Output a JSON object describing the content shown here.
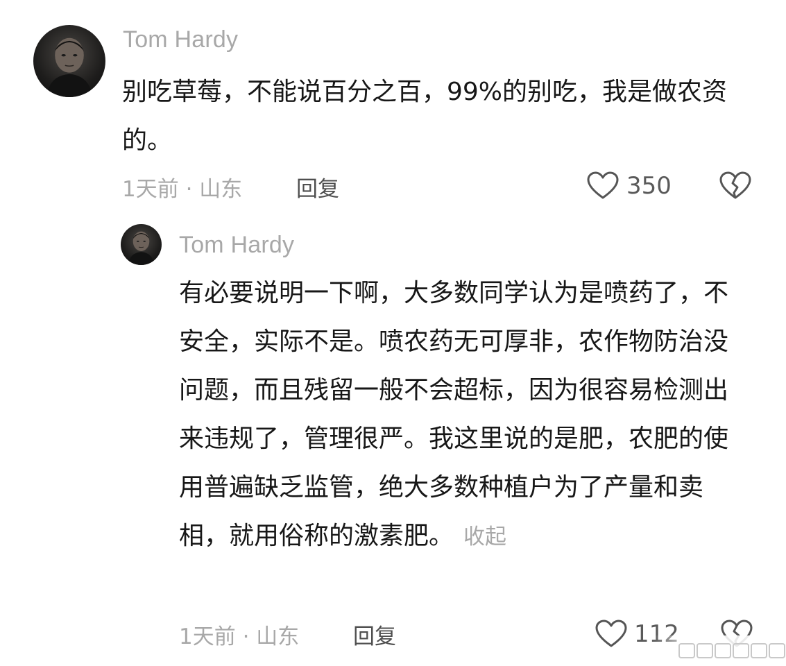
{
  "comment": {
    "username": "Tom Hardy",
    "text": "别吃草莓，不能说百分之百，99%的别吃，我是做农资的。",
    "meta": "1天前 · 山东",
    "reply_label": "回复",
    "like_count": "350"
  },
  "reply": {
    "username": "Tom Hardy",
    "text": "有必要说明一下啊，大多数同学认为是喷药了，不安全，实际不是。喷农药无可厚非，农作物防治没问题，而且残留一般不会超标，因为很容易检测出来违规了，管理很严。我这里说的是肥，农肥的使用普遍缺乏监管，绝大多数种植户为了产量和卖相，就用俗称的激素肥。",
    "collapse_label": "收起",
    "meta": "1天前 · 山东",
    "reply_label": "回复",
    "like_count": "112"
  },
  "icons": {
    "like": "heart-outline-icon",
    "dislike": "broken-heart-icon"
  },
  "colors": {
    "username": "#a8a8a8",
    "meta": "#a8a8a8",
    "text": "#171717"
  }
}
